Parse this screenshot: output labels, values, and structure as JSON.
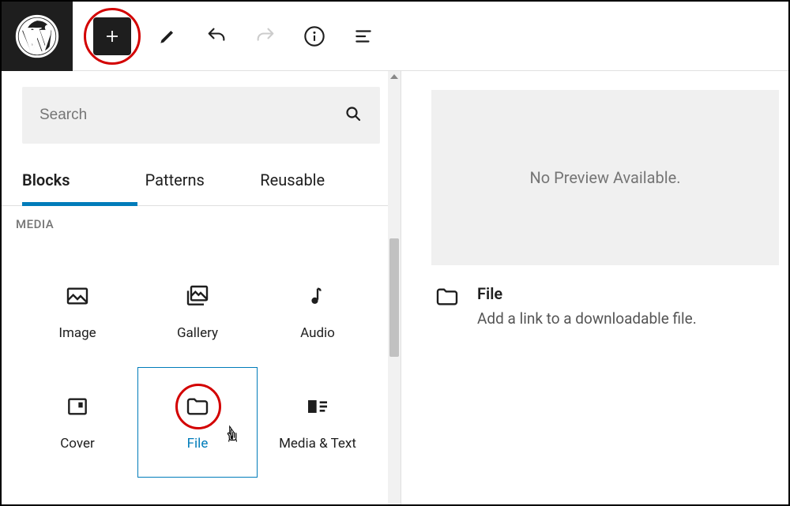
{
  "toolbar": {
    "search_placeholder": "Search"
  },
  "tabs": [
    "Blocks",
    "Patterns",
    "Reusable"
  ],
  "section_label": "MEDIA",
  "blocks": [
    {
      "label": "Image"
    },
    {
      "label": "Gallery"
    },
    {
      "label": "Audio"
    },
    {
      "label": "Cover"
    },
    {
      "label": "File"
    },
    {
      "label": "Media & Text"
    }
  ],
  "preview": {
    "placeholder": "No Preview Available.",
    "title": "File",
    "description": "Add a link to a downloadable file."
  }
}
